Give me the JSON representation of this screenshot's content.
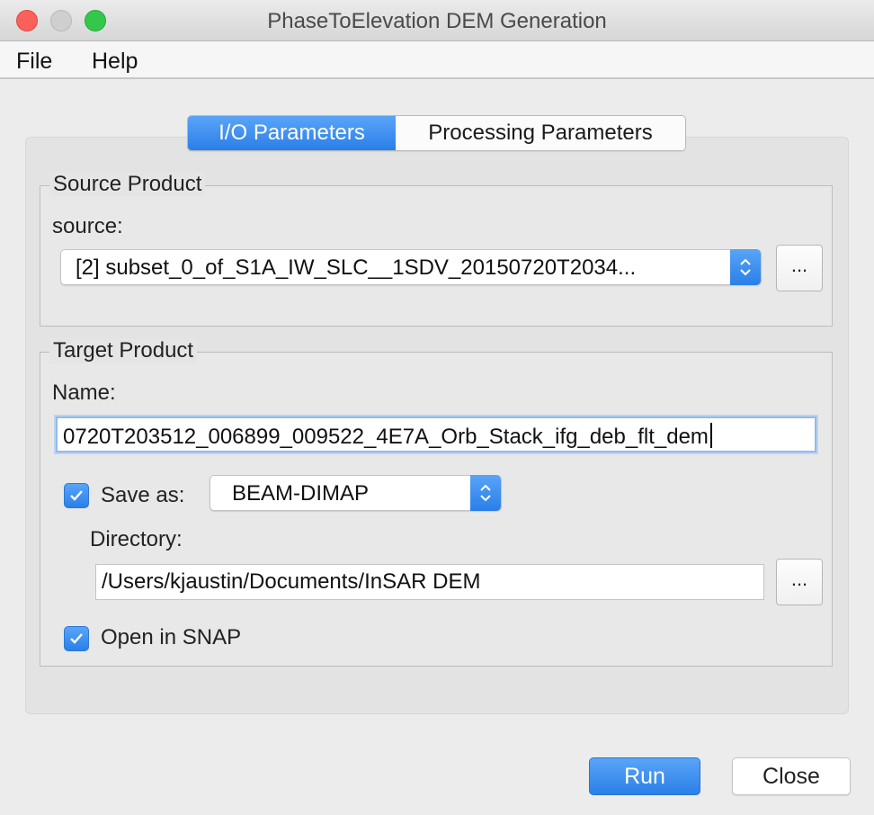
{
  "window": {
    "title": "PhaseToElevation DEM Generation"
  },
  "menu": {
    "file": "File",
    "help": "Help"
  },
  "tabs": [
    {
      "label": "I/O Parameters",
      "active": true
    },
    {
      "label": "Processing Parameters",
      "active": false
    }
  ],
  "source_product": {
    "legend": "Source Product",
    "source_label": "source:",
    "source_value": "[2] subset_0_of_S1A_IW_SLC__1SDV_20150720T2034...",
    "browse_label": "..."
  },
  "target_product": {
    "legend": "Target Product",
    "name_label": "Name:",
    "name_value": "0720T203512_006899_009522_4E7A_Orb_Stack_ifg_deb_flt_dem",
    "save_as_label": "Save as:",
    "save_as_checked": true,
    "format_value": "BEAM-DIMAP",
    "directory_label": "Directory:",
    "directory_value": "/Users/kjaustin/Documents/InSAR DEM",
    "browse_label": "...",
    "open_in_snap_label": "Open in SNAP",
    "open_in_snap_checked": true
  },
  "buttons": {
    "run": "Run",
    "close": "Close"
  },
  "colors": {
    "accent": "#2a7fe8",
    "close_light": "#fc605b",
    "max_light": "#34c84a"
  }
}
